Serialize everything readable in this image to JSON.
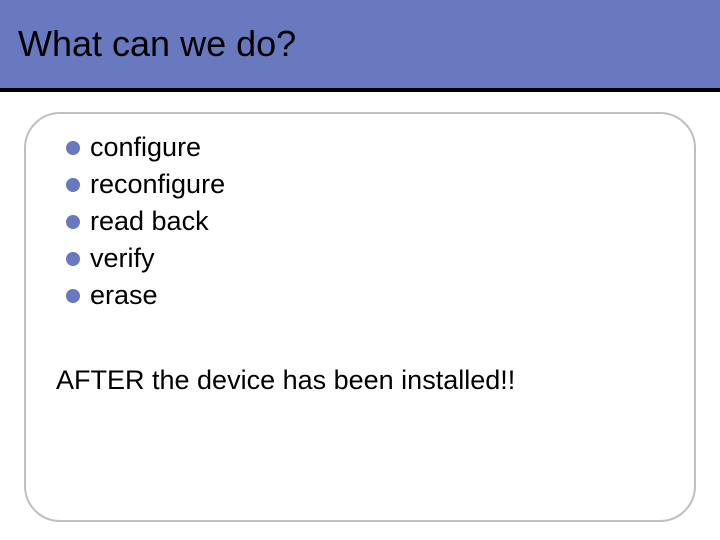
{
  "header": {
    "title": "What can we do?"
  },
  "bullets": {
    "items": [
      {
        "label": "configure"
      },
      {
        "label": "reconfigure"
      },
      {
        "label": "read back"
      },
      {
        "label": "verify"
      },
      {
        "label": "erase"
      }
    ]
  },
  "footer": {
    "text": "AFTER the device has been installed!!"
  }
}
